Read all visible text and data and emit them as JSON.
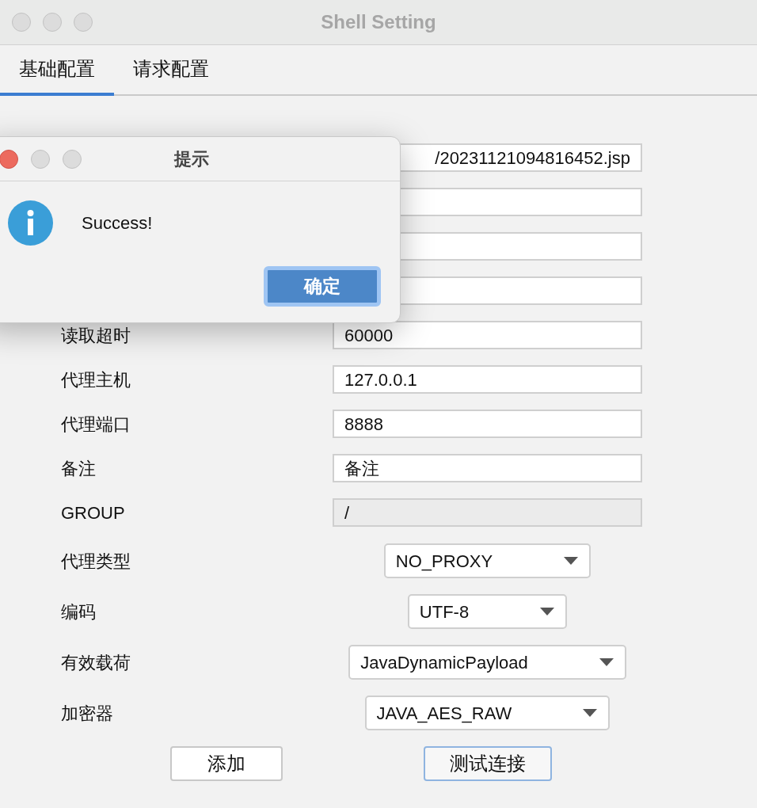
{
  "window": {
    "title": "Shell Setting"
  },
  "tabs": [
    {
      "label": "基础配置",
      "selected": true
    },
    {
      "label": "请求配置",
      "selected": false
    }
  ],
  "fields": [
    {
      "value": "/20231121094816452.jsp",
      "scrolled_to_end": true,
      "disabled": false
    },
    {
      "disabled": false
    },
    {
      "disabled": false
    },
    {
      "disabled": false
    },
    {
      "label": "读取超时",
      "value": "60000",
      "disabled": false
    },
    {
      "label": "代理主机",
      "value": "127.0.0.1",
      "disabled": false
    },
    {
      "label": "代理端口",
      "value": "8888",
      "disabled": false
    },
    {
      "label": "备注",
      "value": "备注",
      "disabled": false
    },
    {
      "label": "GROUP",
      "value": "/",
      "disabled": true
    }
  ],
  "combos": [
    {
      "label": "代理类型",
      "value": "NO_PROXY"
    },
    {
      "label": "编码",
      "value": "UTF-8"
    },
    {
      "label": "有效载荷",
      "value": "JavaDynamicPayload"
    },
    {
      "label": "加密器",
      "value": "JAVA_AES_RAW"
    }
  ],
  "buttons": [
    {
      "label": "添加",
      "focused": false
    },
    {
      "label": "测试连接",
      "focused": true
    }
  ],
  "dialog": {
    "title": "提示",
    "message": "Success!",
    "button": {
      "label": "确定",
      "focused": true
    }
  }
}
